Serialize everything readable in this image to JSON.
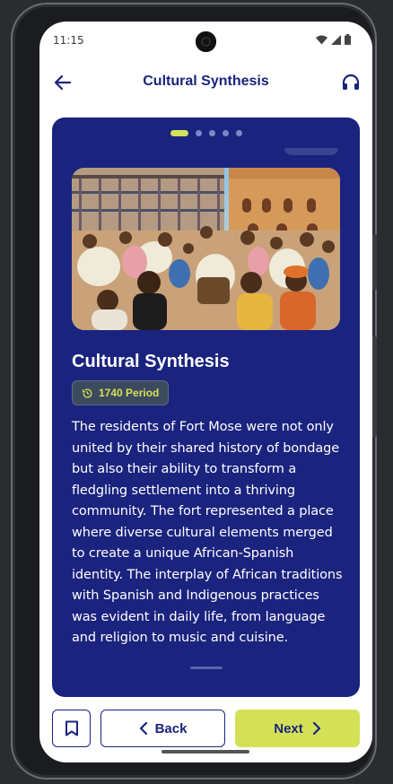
{
  "status_bar": {
    "time": "11:15"
  },
  "app_bar": {
    "title": "Cultural Synthesis",
    "back_icon": "arrow-left-icon",
    "audio_icon": "headphones-icon"
  },
  "pager": {
    "count": 5,
    "active_index": 0
  },
  "card": {
    "title": "Cultural Synthesis",
    "period_badge": "1740 Period",
    "body": "The residents of Fort Mose were not only united by their shared history of bondage but also their ability to transform a fledgling settlement into a thriving community. The fort represented a place where diverse cultural elements merged to create a unique African-Spanish identity. The interplay of African traditions with Spanish and Indigenous practices was evident in daily life, from language and religion to music and cuisine."
  },
  "actions": {
    "back_label": "Back",
    "next_label": "Next"
  },
  "colors": {
    "primary": "#1a237e",
    "accent": "#d4e157",
    "background": "#ffffff"
  }
}
